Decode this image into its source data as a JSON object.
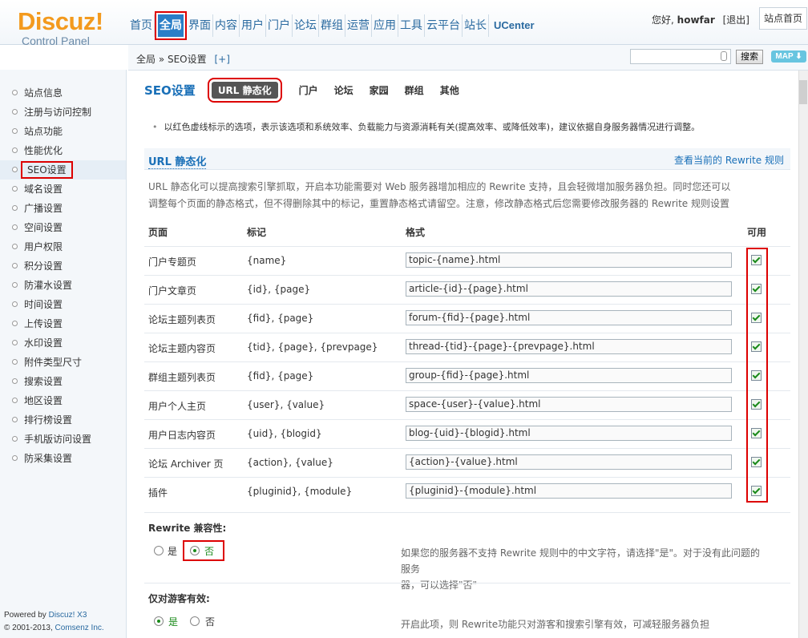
{
  "logo": {
    "title": "Discuz!",
    "subtitle": "Control Panel"
  },
  "nav": {
    "items": [
      "首页",
      "全局",
      "界面",
      "内容",
      "用户",
      "门户",
      "论坛",
      "群组",
      "运营",
      "应用",
      "工具",
      "云平台",
      "站长",
      "UCenter"
    ],
    "active_index": 1
  },
  "user": {
    "greeting": "您好,",
    "name": "howfar",
    "logout": "[退出]",
    "home_button": "站点首页"
  },
  "breadcrumb": {
    "path": "全局 » SEO设置",
    "plus": "[+]"
  },
  "search": {
    "placeholder": "",
    "button": "搜索",
    "map": "MAP ⬇"
  },
  "sidebar": {
    "items": [
      "站点信息",
      "注册与访问控制",
      "站点功能",
      "性能优化",
      "SEO设置",
      "域名设置",
      "广播设置",
      "空间设置",
      "用户权限",
      "积分设置",
      "防灌水设置",
      "时间设置",
      "上传设置",
      "水印设置",
      "附件类型尺寸",
      "搜索设置",
      "地区设置",
      "排行榜设置",
      "手机版访问设置",
      "防采集设置"
    ],
    "active_index": 4
  },
  "footer": {
    "powered": "Powered by",
    "brand": "Discuz! X3",
    "copyright": "© 2001-2013,",
    "company": "Comsenz Inc."
  },
  "main": {
    "title": "SEO设置",
    "tabs": [
      "URL 静态化",
      "门户",
      "论坛",
      "家园",
      "群组",
      "其他"
    ],
    "tip": "以红色虚线标示的选项，表示该选项和系统效率、负载能力与资源消耗有关(提高效率、或降低效率)，建议依据自身服务器情况进行调整。",
    "section_title": "URL 静态化",
    "section_link": "查看当前的 Rewrite 规则",
    "desc_line1": "URL 静态化可以提高搜索引擎抓取，开启本功能需要对 Web 服务器增加相应的 Rewrite 支持，且会轻微增加服务器负担。同时您还可以",
    "desc_line2": "调整每个页面的静态格式，但不得删除其中的标记，重置静态格式请留空。注意，修改静态格式后您需要修改服务器的 Rewrite 规则设置",
    "table_headers": {
      "page": "页面",
      "tag": "标记",
      "format": "格式",
      "enabled": "可用"
    },
    "rows": [
      {
        "page": "门户专题页",
        "tag": "{name}",
        "format": "topic-{name}.html",
        "enabled": true
      },
      {
        "page": "门户文章页",
        "tag": "{id}, {page}",
        "format": "article-{id}-{page}.html",
        "enabled": true
      },
      {
        "page": "论坛主题列表页",
        "tag": "{fid}, {page}",
        "format": "forum-{fid}-{page}.html",
        "enabled": true
      },
      {
        "page": "论坛主题内容页",
        "tag": "{tid}, {page}, {prevpage}",
        "format": "thread-{tid}-{page}-{prevpage}.html",
        "enabled": true
      },
      {
        "page": "群组主题列表页",
        "tag": "{fid}, {page}",
        "format": "group-{fid}-{page}.html",
        "enabled": true
      },
      {
        "page": "用户个人主页",
        "tag": "{user}, {value}",
        "format": "space-{user}-{value}.html",
        "enabled": true
      },
      {
        "page": "用户日志内容页",
        "tag": "{uid}, {blogid}",
        "format": "blog-{uid}-{blogid}.html",
        "enabled": true
      },
      {
        "page": "论坛 Archiver 页",
        "tag": "{action}, {value}",
        "format": "{action}-{value}.html",
        "enabled": true
      },
      {
        "page": "插件",
        "tag": "{pluginid}, {module}",
        "format": "{pluginid}-{module}.html",
        "enabled": true
      }
    ],
    "rewrite_compat": {
      "label": "Rewrite 兼容性:",
      "yes": "是",
      "no": "否",
      "selected": "no",
      "desc_line1": "如果您的服务器不支持 Rewrite 规则中的中文字符，请选择\"是\"。对于没有此问题的服务",
      "desc_line2": "器，可以选择\"否\""
    },
    "guest_only": {
      "label": "仅对游客有效:",
      "yes": "是",
      "no": "否",
      "selected": "yes",
      "desc": "开启此项，则 Rewrite功能只对游客和搜索引擎有效，可减轻服务器负担"
    }
  }
}
